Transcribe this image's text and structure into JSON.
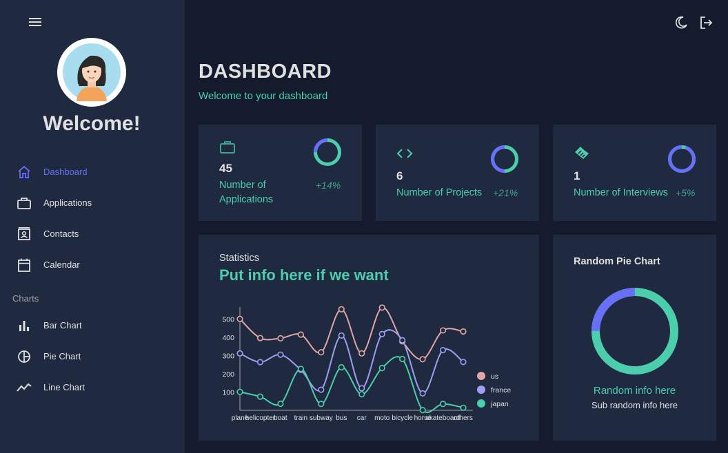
{
  "sidebar": {
    "welcome": "Welcome!",
    "items": [
      {
        "label": "Dashboard",
        "icon": "home-icon"
      },
      {
        "label": "Applications",
        "icon": "briefcase-icon"
      },
      {
        "label": "Contacts",
        "icon": "contacts-icon"
      },
      {
        "label": "Calendar",
        "icon": "calendar-icon"
      }
    ],
    "section_charts": "Charts",
    "chart_items": [
      {
        "label": "Bar Chart",
        "icon": "bar-chart-icon"
      },
      {
        "label": "Pie Chart",
        "icon": "pie-chart-icon"
      },
      {
        "label": "Line Chart",
        "icon": "line-chart-icon"
      }
    ]
  },
  "topbar": {
    "theme_icon": "moon-icon",
    "logout_icon": "logout-icon"
  },
  "header": {
    "title": "DASHBOARD",
    "subtitle": "Welcome to your dashboard"
  },
  "stats": [
    {
      "value": "45",
      "label_line1": "Number of",
      "label_line2": "Applications",
      "increase": "+14%",
      "progress": 0.75,
      "icon": "briefcase-icon"
    },
    {
      "value": "6",
      "label": "Number of Projects",
      "increase": "+21%",
      "progress": 0.5,
      "icon": "code-icon"
    },
    {
      "value": "1",
      "label": "Number of Interviews",
      "increase": "+5%",
      "progress": 0.05,
      "icon": "handshake-icon"
    }
  ],
  "statistics": {
    "title": "Statistics",
    "headline": "Put info here if we want"
  },
  "pie_card": {
    "title": "Random Pie Chart",
    "info": "Random info here",
    "sub": "Sub random info here",
    "progress": 0.75
  },
  "colors": {
    "accent": "#4cceac",
    "active": "#6870fa",
    "us": "#e2a6a6",
    "france": "#9d9ff0",
    "japan": "#4cceac"
  },
  "chart_data": {
    "type": "line",
    "categories": [
      "plane",
      "helicopter",
      "boat",
      "train",
      "subway",
      "bus",
      "car",
      "moto",
      "bicycle",
      "horse",
      "skateboard",
      "others"
    ],
    "ylim": [
      0,
      600
    ],
    "yticks": [
      100,
      200,
      300,
      400,
      500
    ],
    "legend_position": "right",
    "series": [
      {
        "name": "us",
        "color": "#e2a6a6",
        "values": [
          501,
          396,
          395,
          415,
          318,
          554,
          312,
          563,
          378,
          280,
          438,
          432
        ]
      },
      {
        "name": "france",
        "color": "#9d9ff0",
        "values": [
          312,
          264,
          305,
          222,
          113,
          410,
          121,
          418,
          384,
          93,
          330,
          265
        ]
      },
      {
        "name": "japan",
        "color": "#4cceac",
        "values": [
          101,
          75,
          36,
          227,
          35,
          236,
          88,
          232,
          281,
          1,
          35,
          14
        ]
      }
    ]
  }
}
